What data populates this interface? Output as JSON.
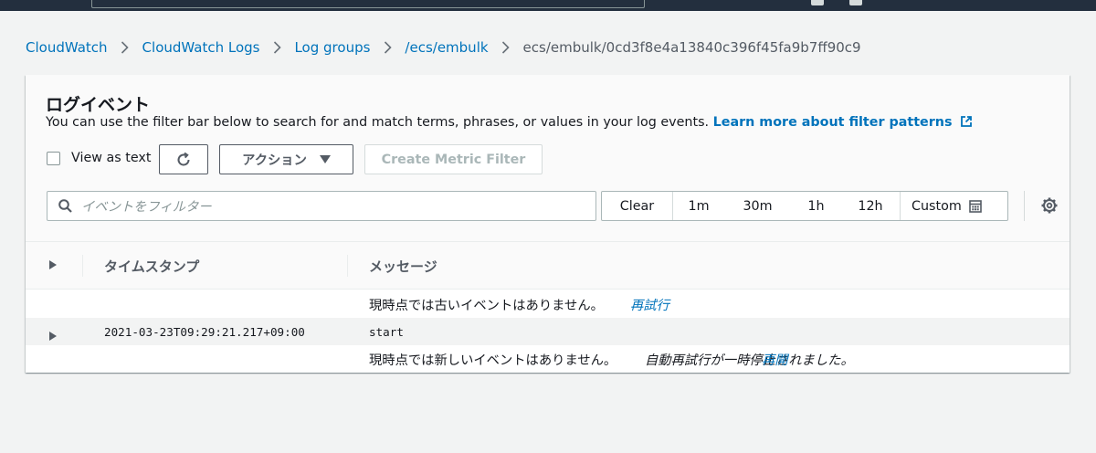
{
  "breadcrumb": {
    "items": [
      "CloudWatch",
      "CloudWatch Logs",
      "Log groups",
      "/ecs/embulk"
    ],
    "current": "ecs/embulk/0cd3f8e4a13840c396f45fa9b7ff90c9"
  },
  "panel": {
    "title": "ログイベント",
    "description": "You can use the filter bar below to search for and match terms, phrases, or values in your log events.",
    "learn_more": "Learn more about filter patterns"
  },
  "toolbar": {
    "view_as_text": "View as text",
    "actions_label": "アクション",
    "create_metric_filter": "Create Metric Filter"
  },
  "filter": {
    "placeholder": "イベントをフィルター"
  },
  "time_range": {
    "clear": "Clear",
    "options": [
      "1m",
      "30m",
      "1h",
      "12h"
    ],
    "custom": "Custom"
  },
  "table": {
    "headers": {
      "timestamp": "タイムスタンプ",
      "message": "メッセージ"
    },
    "older_notice": "現時点では古いイベントはありません。",
    "retry_label": "再試行",
    "events": [
      {
        "timestamp": "2021-03-23T09:29:21.217+09:00",
        "message": "start"
      }
    ],
    "newer_notice": "現時点では新しいイベントはありません。",
    "auto_retry_text": "自動再試行が一時停止されました。",
    "resume_label": "再開"
  },
  "colors": {
    "link": "#0073bb",
    "topbar": "#232f3e",
    "background": "#f2f3f3"
  }
}
